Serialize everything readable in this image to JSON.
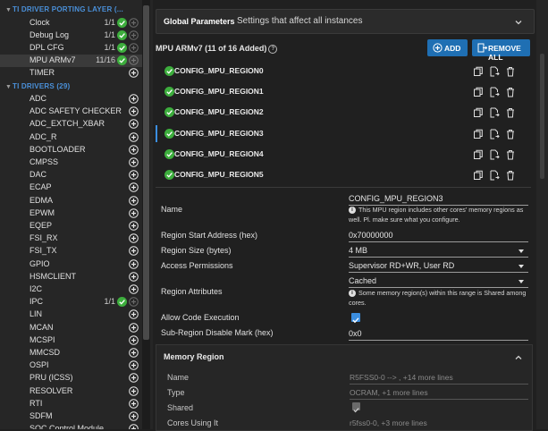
{
  "sidebar": {
    "porting_section": "TI DRIVER PORTING LAYER (...",
    "porting_items": [
      {
        "label": "Clock",
        "count": "1/1",
        "has_check": true
      },
      {
        "label": "Debug Log",
        "count": "1/1",
        "has_check": true
      },
      {
        "label": "DPL CFG",
        "count": "1/1",
        "has_check": true
      },
      {
        "label": "MPU ARMv7",
        "count": "11/16",
        "has_check": true,
        "selected": true
      },
      {
        "label": "TIMER",
        "count": "",
        "has_check": false
      }
    ],
    "drivers_section": "TI DRIVERS (29)",
    "driver_items": [
      {
        "label": "ADC",
        "count": ""
      },
      {
        "label": "ADC SAFETY CHECKER",
        "count": ""
      },
      {
        "label": "ADC_EXTCH_XBAR",
        "count": ""
      },
      {
        "label": "ADC_R",
        "count": ""
      },
      {
        "label": "BOOTLOADER",
        "count": ""
      },
      {
        "label": "CMPSS",
        "count": ""
      },
      {
        "label": "DAC",
        "count": ""
      },
      {
        "label": "ECAP",
        "count": ""
      },
      {
        "label": "EDMA",
        "count": ""
      },
      {
        "label": "EPWM",
        "count": ""
      },
      {
        "label": "EQEP",
        "count": ""
      },
      {
        "label": "FSI_RX",
        "count": ""
      },
      {
        "label": "FSI_TX",
        "count": ""
      },
      {
        "label": "GPIO",
        "count": ""
      },
      {
        "label": "HSMCLIENT",
        "count": ""
      },
      {
        "label": "I2C",
        "count": ""
      },
      {
        "label": "IPC",
        "count": "1/1",
        "has_check": true
      },
      {
        "label": "LIN",
        "count": ""
      },
      {
        "label": "MCAN",
        "count": ""
      },
      {
        "label": "MCSPI",
        "count": ""
      },
      {
        "label": "MMCSD",
        "count": ""
      },
      {
        "label": "OSPI",
        "count": ""
      },
      {
        "label": "PRU (ICSS)",
        "count": ""
      },
      {
        "label": "RESOLVER",
        "count": ""
      },
      {
        "label": "RTI",
        "count": ""
      },
      {
        "label": "SDFM",
        "count": ""
      },
      {
        "label": "SOC Control Module",
        "count": ""
      }
    ]
  },
  "global_params": {
    "title": "Global Parameters",
    "subtitle": "Settings that affect all instances"
  },
  "mpu": {
    "title": "MPU ARMv7 (11 of 16 Added)",
    "add_label": "ADD",
    "remove_all_label": "REMOVE ALL",
    "regions": [
      "CONFIG_MPU_REGION0",
      "CONFIG_MPU_REGION1",
      "CONFIG_MPU_REGION2",
      "CONFIG_MPU_REGION3",
      "CONFIG_MPU_REGION4",
      "CONFIG_MPU_REGION5"
    ],
    "selected_region_index": 3
  },
  "props": {
    "name_label": "Name",
    "name_value": "CONFIG_MPU_REGION3",
    "name_info": "This MPU region includes other cores' memory regions as well. Pl. make sure what you configure.",
    "start_label": "Region Start Address (hex)",
    "start_value": "0x70000000",
    "size_label": "Region Size (bytes)",
    "size_value": "4 MB",
    "access_label": "Access Permissions",
    "access_value": "Supervisor RD+WR, User RD",
    "attr_label": "Region Attributes",
    "attr_value": "Cached",
    "attr_info": "Some memory region(s) within this range is Shared among cores.",
    "exec_label": "Allow Code Execution",
    "exec_checked": true,
    "subregion_label": "Sub-Region Disable Mark (hex)",
    "subregion_value": "0x0"
  },
  "memory_region": {
    "title": "Memory Region",
    "name_label": "Name",
    "name_value": "R5FSS0-0 --> , +14 more lines",
    "type_label": "Type",
    "type_value": "OCRAM, +1 more lines",
    "shared_label": "Shared",
    "shared_checked": true,
    "cores_label": "Cores Using It",
    "cores_value": "r5fss0-0, +3 more lines"
  },
  "colors": {
    "accent": "#1f6fb3",
    "check_green": "#3dae3d",
    "section_blue": "#4a90d9"
  }
}
